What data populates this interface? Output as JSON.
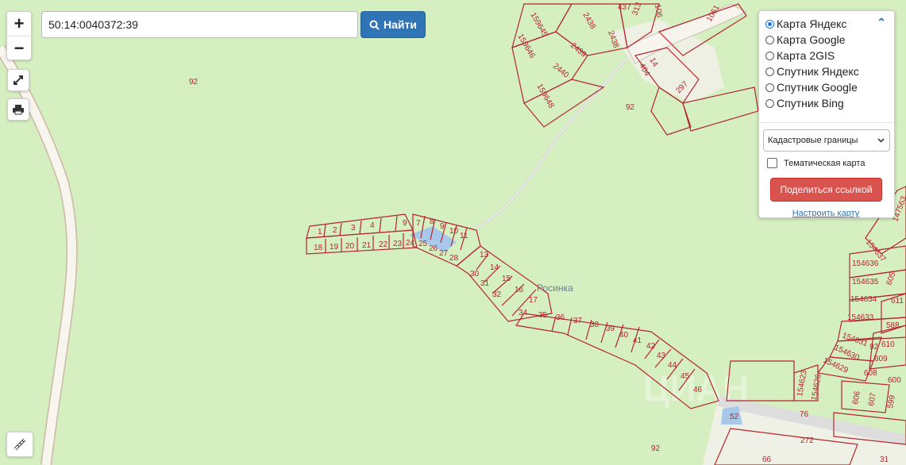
{
  "search": {
    "value": "50:14:0040372:39",
    "button_label": "Найти"
  },
  "controls": {
    "zoom_in": "+",
    "zoom_out": "−"
  },
  "layers": {
    "options": [
      {
        "label": "Карта Яндекс",
        "selected": true
      },
      {
        "label": "Карта Google",
        "selected": false
      },
      {
        "label": "Карта 2GIS",
        "selected": false
      },
      {
        "label": "Спутник Яндекс",
        "selected": false
      },
      {
        "label": "Спутник Google",
        "selected": false
      },
      {
        "label": "Спутник Bing",
        "selected": false
      }
    ],
    "select_value": "Кадастровые границы",
    "thematic_label": "Тематическая карта",
    "share_label": "Поделиться ссылкой",
    "configure_label": "Настроить карту"
  },
  "map": {
    "place_label": "Росинка",
    "plot_labels": [
      "1",
      "2",
      "3",
      "4",
      "9",
      "7",
      "8",
      "9",
      "10",
      "11",
      "18",
      "19",
      "20",
      "21",
      "22",
      "23",
      "24",
      "25",
      "26",
      "27",
      "28",
      "13",
      "14",
      "15",
      "16",
      "17",
      "30",
      "31",
      "32",
      "34",
      "35",
      "36",
      "37",
      "38",
      "39",
      "40",
      "41",
      "42",
      "43",
      "44",
      "45",
      "46",
      "52",
      "76",
      "272",
      "66",
      "31",
      "92",
      "92",
      "92",
      "92",
      "159645",
      "159646",
      "159648",
      "2438",
      "2438",
      "2439",
      "2440",
      "313",
      "404",
      "14",
      "297",
      "1061",
      "106",
      "437",
      "154636",
      "154635",
      "154634",
      "154633",
      "154631",
      "154630",
      "154629",
      "154623",
      "154626",
      "154637",
      "147563",
      "605",
      "611",
      "588",
      "610",
      "609",
      "608",
      "607",
      "606",
      "600",
      "599"
    ],
    "colors": {
      "land": "#d6efc0",
      "boundary": "#b5252c",
      "road": "#f5f2ea",
      "water": "#a8c8ea"
    }
  }
}
